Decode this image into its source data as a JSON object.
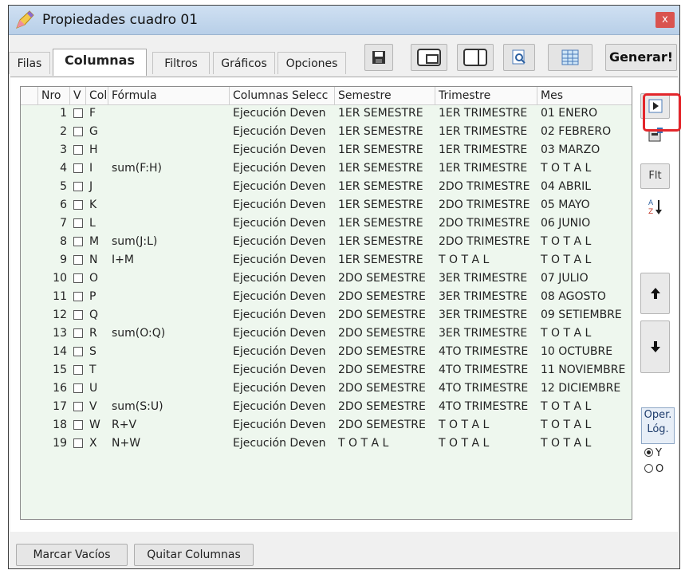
{
  "window": {
    "title": "Propiedades cuadro 01",
    "close_label": "x"
  },
  "tabs": [
    {
      "label": "Filas"
    },
    {
      "label": "Columnas"
    },
    {
      "label": "Filtros"
    },
    {
      "label": "Gráficos"
    },
    {
      "label": "Opciones"
    }
  ],
  "toolbar": {
    "generate_label": "Generar!"
  },
  "grid": {
    "headers": [
      "Nro",
      "V",
      "Col",
      "Fórmula",
      "Columnas Selecc",
      "Semestre",
      "Trimestre",
      "Mes"
    ],
    "rows": [
      {
        "nro": "1",
        "col": "F",
        "formula": "",
        "sel": "Ejecución Deven",
        "semestre": "1ER SEMESTRE",
        "trimestre": "1ER TRIMESTRE",
        "mes": "01 ENERO"
      },
      {
        "nro": "2",
        "col": "G",
        "formula": "",
        "sel": "Ejecución Deven",
        "semestre": "1ER SEMESTRE",
        "trimestre": "1ER TRIMESTRE",
        "mes": "02 FEBRERO"
      },
      {
        "nro": "3",
        "col": "H",
        "formula": "",
        "sel": "Ejecución Deven",
        "semestre": "1ER SEMESTRE",
        "trimestre": "1ER TRIMESTRE",
        "mes": "03 MARZO"
      },
      {
        "nro": "4",
        "col": "I",
        "formula": "sum(F:H)",
        "sel": "Ejecución Deven",
        "semestre": "1ER SEMESTRE",
        "trimestre": "1ER TRIMESTRE",
        "mes": "T O T A L"
      },
      {
        "nro": "5",
        "col": "J",
        "formula": "",
        "sel": "Ejecución Deven",
        "semestre": "1ER SEMESTRE",
        "trimestre": "2DO TRIMESTRE",
        "mes": "04 ABRIL"
      },
      {
        "nro": "6",
        "col": "K",
        "formula": "",
        "sel": "Ejecución Deven",
        "semestre": "1ER SEMESTRE",
        "trimestre": "2DO TRIMESTRE",
        "mes": "05 MAYO"
      },
      {
        "nro": "7",
        "col": "L",
        "formula": "",
        "sel": "Ejecución Deven",
        "semestre": "1ER SEMESTRE",
        "trimestre": "2DO TRIMESTRE",
        "mes": "06 JUNIO"
      },
      {
        "nro": "8",
        "col": "M",
        "formula": "sum(J:L)",
        "sel": "Ejecución Deven",
        "semestre": "1ER SEMESTRE",
        "trimestre": "2DO TRIMESTRE",
        "mes": "T O T A L"
      },
      {
        "nro": "9",
        "col": "N",
        "formula": "I+M",
        "sel": "Ejecución Deven",
        "semestre": "1ER SEMESTRE",
        "trimestre": "T O T A L",
        "mes": "T O T A L"
      },
      {
        "nro": "10",
        "col": "O",
        "formula": "",
        "sel": "Ejecución Deven",
        "semestre": "2DO SEMESTRE",
        "trimestre": "3ER TRIMESTRE",
        "mes": "07 JULIO"
      },
      {
        "nro": "11",
        "col": "P",
        "formula": "",
        "sel": "Ejecución Deven",
        "semestre": "2DO SEMESTRE",
        "trimestre": "3ER TRIMESTRE",
        "mes": "08 AGOSTO"
      },
      {
        "nro": "12",
        "col": "Q",
        "formula": "",
        "sel": "Ejecución Deven",
        "semestre": "2DO SEMESTRE",
        "trimestre": "3ER TRIMESTRE",
        "mes": "09 SETIEMBRE"
      },
      {
        "nro": "13",
        "col": "R",
        "formula": "sum(O:Q)",
        "sel": "Ejecución Deven",
        "semestre": "2DO SEMESTRE",
        "trimestre": "3ER TRIMESTRE",
        "mes": "T O T A L"
      },
      {
        "nro": "14",
        "col": "S",
        "formula": "",
        "sel": "Ejecución Deven",
        "semestre": "2DO SEMESTRE",
        "trimestre": "4TO TRIMESTRE",
        "mes": "10 OCTUBRE"
      },
      {
        "nro": "15",
        "col": "T",
        "formula": "",
        "sel": "Ejecución Deven",
        "semestre": "2DO SEMESTRE",
        "trimestre": "4TO TRIMESTRE",
        "mes": "11 NOVIEMBRE"
      },
      {
        "nro": "16",
        "col": "U",
        "formula": "",
        "sel": "Ejecución Deven",
        "semestre": "2DO SEMESTRE",
        "trimestre": "4TO TRIMESTRE",
        "mes": "12 DICIEMBRE"
      },
      {
        "nro": "17",
        "col": "V",
        "formula": "sum(S:U)",
        "sel": "Ejecución Deven",
        "semestre": "2DO SEMESTRE",
        "trimestre": "4TO TRIMESTRE",
        "mes": "T O T A L"
      },
      {
        "nro": "18",
        "col": "W",
        "formula": "R+V",
        "sel": "Ejecución Deven",
        "semestre": "2DO SEMESTRE",
        "trimestre": "T O T A L",
        "mes": "T O T A L"
      },
      {
        "nro": "19",
        "col": "X",
        "formula": "N+W",
        "sel": "Ejecución Deven",
        "semestre": "T O T A L",
        "trimestre": "T O T A L",
        "mes": "T O T A L"
      }
    ]
  },
  "side": {
    "filter_label": "Flt"
  },
  "logic": {
    "title": "Oper. Lóg.",
    "options": [
      "Y",
      "O"
    ],
    "selected": "Y"
  },
  "bottom": {
    "mark_empty_label": "Marcar Vacíos",
    "remove_columns_label": "Quitar Columnas"
  },
  "colors": {
    "highlight": "#e3262b",
    "grid_bg": "#eef7ee"
  }
}
